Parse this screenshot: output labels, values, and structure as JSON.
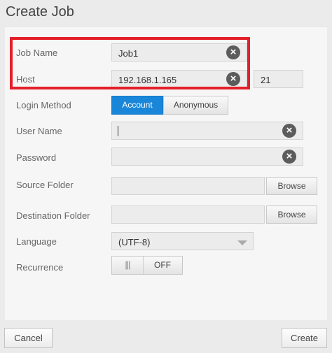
{
  "dialog": {
    "title": "Create Job"
  },
  "form": {
    "job_name": {
      "label": "Job Name",
      "value": "Job1"
    },
    "host": {
      "label": "Host",
      "value": "192.168.1.165",
      "port": "21"
    },
    "login_method": {
      "label": "Login Method",
      "options": [
        "Account",
        "Anonymous"
      ],
      "selected": "Account"
    },
    "user_name": {
      "label": "User Name",
      "value": ""
    },
    "password": {
      "label": "Password",
      "value": ""
    },
    "source_folder": {
      "label": "Source Folder",
      "value": "",
      "browse_label": "Browse"
    },
    "destination_folder": {
      "label": "Destination Folder",
      "value": "",
      "browse_label": "Browse"
    },
    "language": {
      "label": "Language",
      "value": "(UTF-8)"
    },
    "recurrence": {
      "label": "Recurrence",
      "grip": "|||",
      "state": "OFF"
    }
  },
  "footer": {
    "cancel_label": "Cancel",
    "create_label": "Create"
  },
  "colors": {
    "accent": "#1a86d9",
    "highlight": "#e41f2a"
  },
  "icons": {
    "clear": "close-circle-icon",
    "dropdown": "triangle-down-icon"
  }
}
